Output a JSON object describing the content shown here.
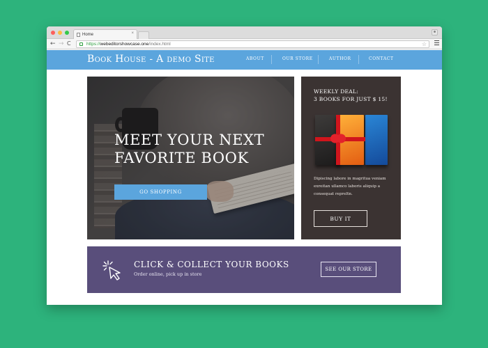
{
  "browser": {
    "tab_title": "Home",
    "tab_close": "×",
    "url_https": "https://",
    "url_host": "webeditorshowcase.one",
    "url_path": "/index.html",
    "nav_back": "←",
    "nav_forward": "→",
    "nav_reload": "C",
    "star": "☆"
  },
  "site": {
    "title": "Book House - A demo Site",
    "nav": [
      "ABOUT",
      "OUR STORE",
      "AUTHOR",
      "CONTACT"
    ],
    "accent_color": "#5ba5dd"
  },
  "hero": {
    "title_line1": "MEET YOUR NEXT",
    "title_line2": "FAVORITE BOOK",
    "button": "GO SHOPPING"
  },
  "deal": {
    "title_line1": "WEEKLY DEAL:",
    "title_line2": "3 BOOKS FOR JUST $ 15!",
    "text": "Dipiscing labore in magritua veniam exreitan ullamco laboris aliquip a consequat repreltn.",
    "button": "BUY IT",
    "bg_color": "#3b3332"
  },
  "banner": {
    "title": "CLICK & COLLECT YOUR BOOKS",
    "subtitle": "Order online, pick up in store",
    "button": "SEE OUR STORE",
    "bg_color": "#594e7b"
  }
}
